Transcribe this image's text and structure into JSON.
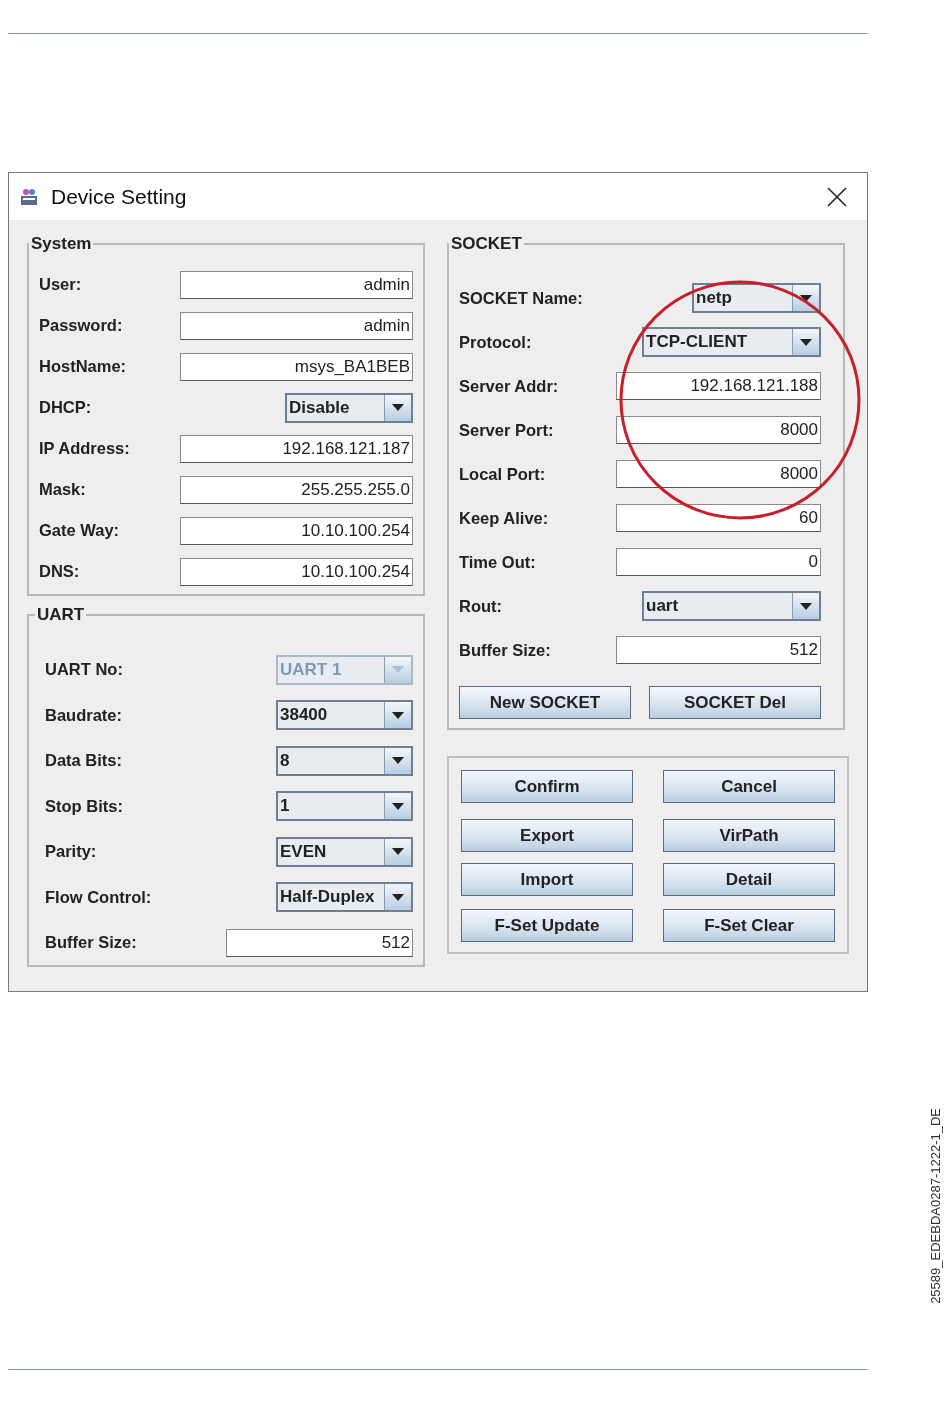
{
  "window": {
    "title": "Device Setting"
  },
  "system": {
    "title": "System",
    "fields": [
      {
        "label": "User:",
        "kind": "text",
        "value": "admin",
        "disabled": false
      },
      {
        "label": "Password:",
        "kind": "text",
        "value": "admin",
        "disabled": false
      },
      {
        "label": "HostName:",
        "kind": "text",
        "value": "msys_BA1BEB",
        "disabled": false
      },
      {
        "label": "DHCP:",
        "kind": "select",
        "value": "Disable",
        "disabled": false
      },
      {
        "label": "IP Address:",
        "kind": "text",
        "value": "192.168.121.187",
        "disabled": false
      },
      {
        "label": "Mask:",
        "kind": "text",
        "value": "255.255.255.0",
        "disabled": false
      },
      {
        "label": "Gate Way:",
        "kind": "text",
        "value": "10.10.100.254",
        "disabled": false
      },
      {
        "label": "DNS:",
        "kind": "text",
        "value": "10.10.100.254",
        "disabled": false
      }
    ]
  },
  "uart": {
    "title": "UART",
    "fields": [
      {
        "label": "UART No:",
        "kind": "select",
        "value": "UART 1",
        "disabled": true
      },
      {
        "label": "Baudrate:",
        "kind": "select",
        "value": "38400",
        "disabled": false
      },
      {
        "label": "Data Bits:",
        "kind": "select",
        "value": "8",
        "disabled": false
      },
      {
        "label": "Stop Bits:",
        "kind": "select",
        "value": "1",
        "disabled": false
      },
      {
        "label": "Parity:",
        "kind": "select",
        "value": "EVEN",
        "disabled": false
      },
      {
        "label": "Flow Control:",
        "kind": "select",
        "value": "Half-Duplex",
        "disabled": false
      },
      {
        "label": "Buffer Size:",
        "kind": "text",
        "value": "512",
        "disabled": false
      }
    ]
  },
  "socket": {
    "title": "SOCKET",
    "fields": [
      {
        "label": "SOCKET Name:",
        "kind": "select",
        "value": "netp",
        "disabled": false
      },
      {
        "label": "Protocol:",
        "kind": "select",
        "value": "TCP-CLIENT",
        "disabled": false
      },
      {
        "label": "Server Addr:",
        "kind": "text",
        "value": "192.168.121.188",
        "disabled": false
      },
      {
        "label": "Server Port:",
        "kind": "text",
        "value": "8000",
        "disabled": false
      },
      {
        "label": "Local Port:",
        "kind": "text",
        "value": "8000",
        "disabled": false
      },
      {
        "label": "Keep Alive:",
        "kind": "text",
        "value": "60",
        "disabled": false
      },
      {
        "label": "Time Out:",
        "kind": "text",
        "value": "0",
        "disabled": false
      },
      {
        "label": "Rout:",
        "kind": "select",
        "value": "uart",
        "disabled": false
      },
      {
        "label": "Buffer Size:",
        "kind": "text",
        "value": "512",
        "disabled": false
      }
    ],
    "buttons": [
      "New SOCKET",
      "SOCKET Del"
    ]
  },
  "actions": [
    "Confirm",
    "Cancel",
    "Export",
    "VirPath",
    "Import",
    "Detail",
    "F-Set Update",
    "F-Set Clear"
  ],
  "highlight": {
    "kind": "ellipse"
  },
  "document_code": "25589_EDEBDA0287-1222-1_DE"
}
